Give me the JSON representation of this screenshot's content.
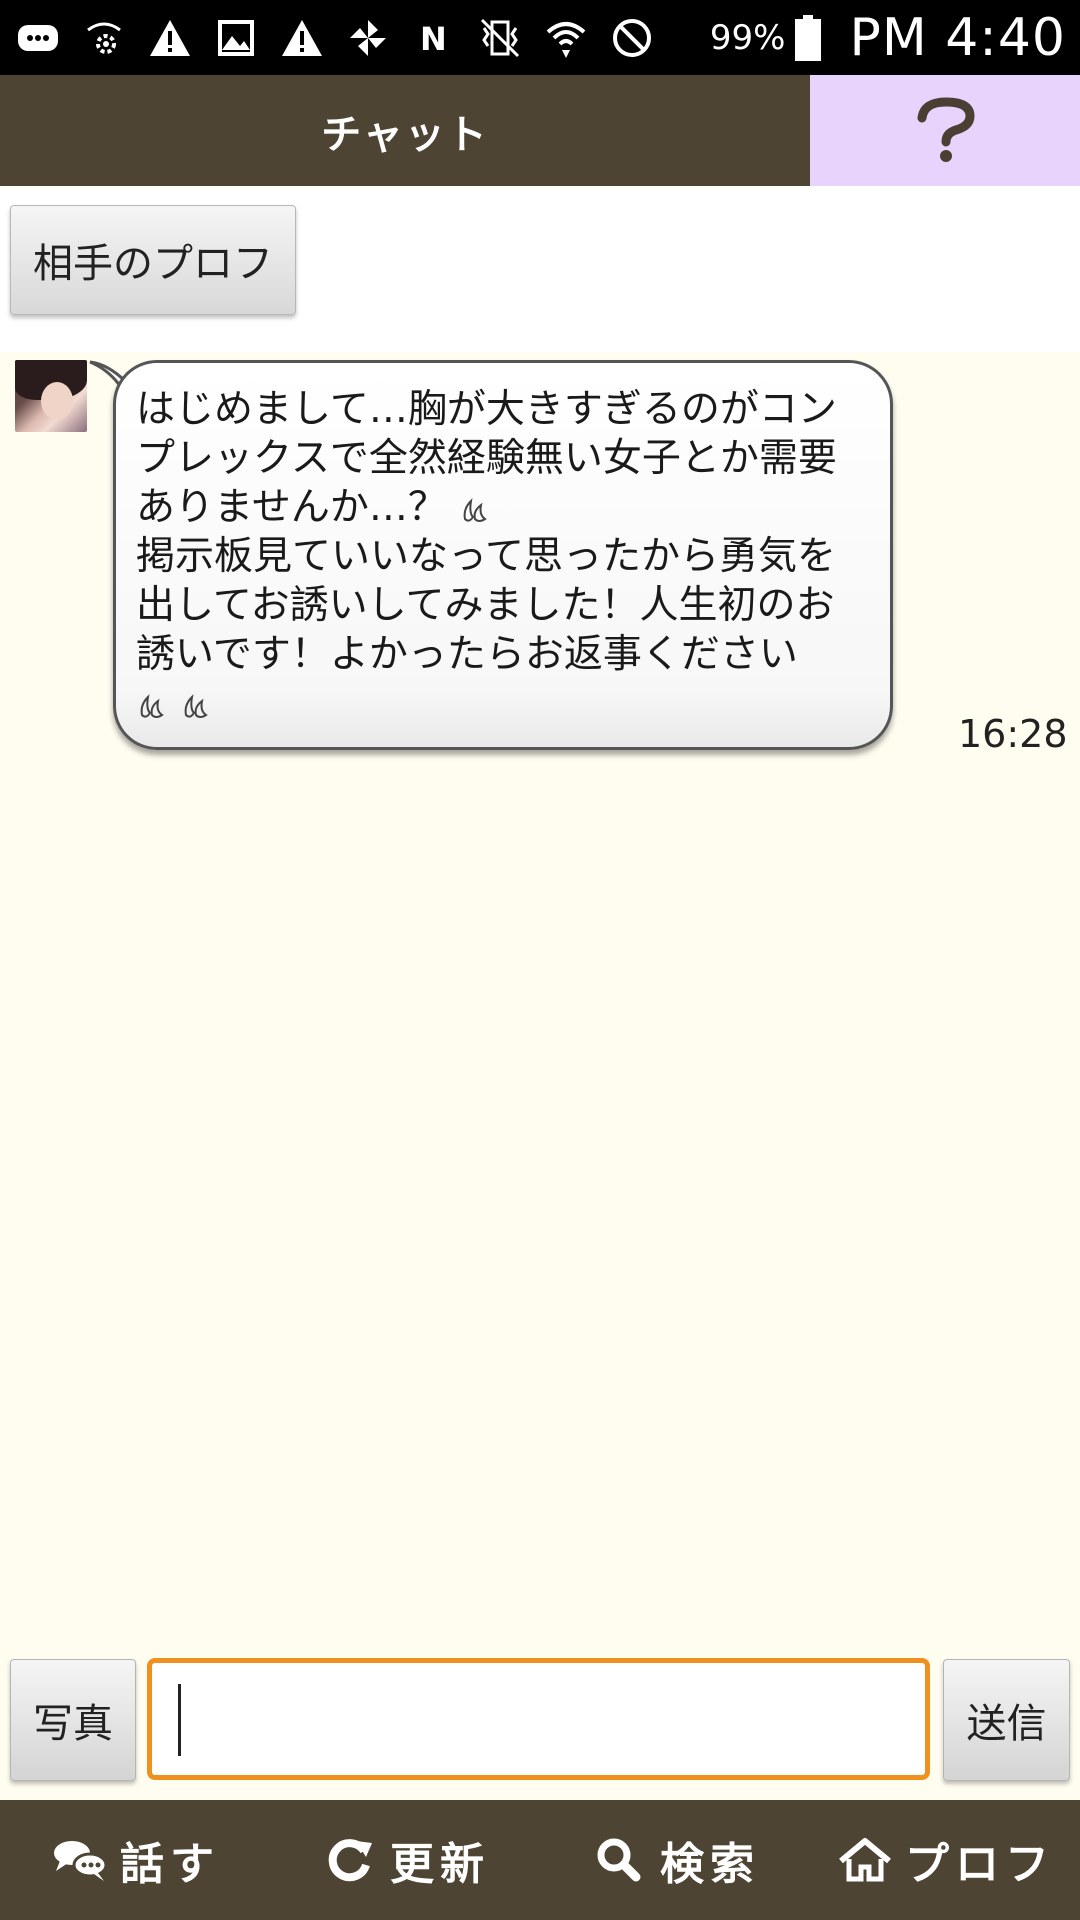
{
  "status_bar": {
    "icons": [
      "chat-bubble-icon",
      "wifi-settings-icon",
      "warning-icon",
      "image-icon",
      "warning-icon",
      "pinwheel-icon",
      "nfc-icon",
      "vibrate-mute-icon",
      "wifi-icon",
      "do-not-disturb-icon"
    ],
    "battery": "99%",
    "time": "PM 4:40"
  },
  "header": {
    "title": "チャット",
    "help_icon": "question-mark-icon",
    "help_bg": "#e8d3fc",
    "bg": "#4e4433"
  },
  "profile_button": {
    "label": "相手のプロフ"
  },
  "messages": [
    {
      "text": "はじめまして…胸が大きすぎるのがコンプレックスで全然経験無い女子とか需要ありませんか…？",
      "text2": "掲示板見ていいなって思ったから勇気を出してお誘いしてみました！人生初のお誘いです！よかったらお返事ください",
      "emoji": "sweat-drop-icon",
      "time": "16:28"
    }
  ],
  "input_bar": {
    "photo_label": "写真",
    "send_label": "送信",
    "input_value": "",
    "accent": "#f0901f"
  },
  "bottom_nav": [
    {
      "label": "話す",
      "icon": "chat-bubbles-icon"
    },
    {
      "label": "更新",
      "icon": "refresh-icon"
    },
    {
      "label": "検索",
      "icon": "search-icon"
    },
    {
      "label": "プロフ",
      "icon": "home-icon"
    }
  ]
}
